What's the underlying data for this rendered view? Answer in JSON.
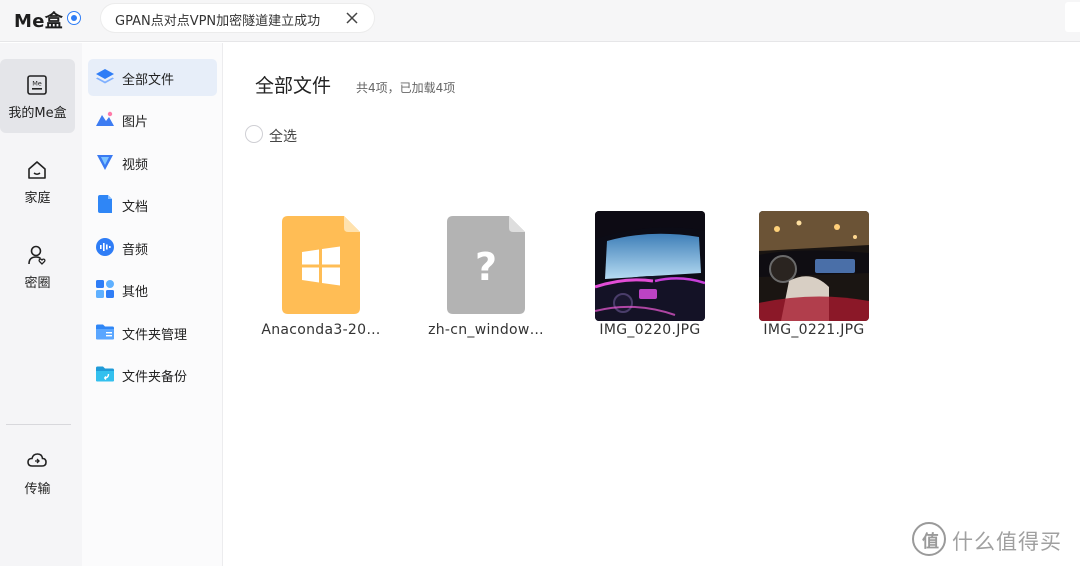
{
  "topbar": {
    "brand": "Me盒",
    "notice": "GPAN点对点VPN加密隧道建立成功"
  },
  "rail": {
    "items": [
      {
        "label": "我的Me盒",
        "icon": "me-box-icon",
        "active": true
      },
      {
        "label": "家庭",
        "icon": "home-icon",
        "active": false
      },
      {
        "label": "密圈",
        "icon": "circle-user-icon",
        "active": false
      },
      {
        "label": "传输",
        "icon": "cloud-transfer-icon",
        "active": false
      }
    ]
  },
  "categories": {
    "items": [
      {
        "label": "全部文件",
        "icon": "layers-icon",
        "active": true
      },
      {
        "label": "图片",
        "icon": "image-icon",
        "active": false
      },
      {
        "label": "视频",
        "icon": "video-icon",
        "active": false
      },
      {
        "label": "文档",
        "icon": "document-icon",
        "active": false
      },
      {
        "label": "音频",
        "icon": "audio-icon",
        "active": false
      },
      {
        "label": "其他",
        "icon": "grid-icon",
        "active": false
      },
      {
        "label": "文件夹管理",
        "icon": "folder-manage-icon",
        "active": false
      },
      {
        "label": "文件夹备份",
        "icon": "folder-backup-icon",
        "active": false
      }
    ]
  },
  "main": {
    "title": "全部文件",
    "count": "共4项，已加载4项",
    "select_all": "全选",
    "files": [
      {
        "name": "Anaconda3-20…",
        "type": "installer"
      },
      {
        "name": "zh-cn_window…",
        "type": "unknown"
      },
      {
        "name": "IMG_0220.JPG",
        "type": "image"
      },
      {
        "name": "IMG_0221.JPG",
        "type": "image"
      }
    ]
  },
  "watermark": {
    "logo": "值",
    "text": "什么值得买"
  },
  "colors": {
    "accent": "#2f7df6",
    "active_category_bg": "#e7eef9",
    "rail_active_bg": "#e4e5e9",
    "installer_orange": "#ffb84d"
  }
}
